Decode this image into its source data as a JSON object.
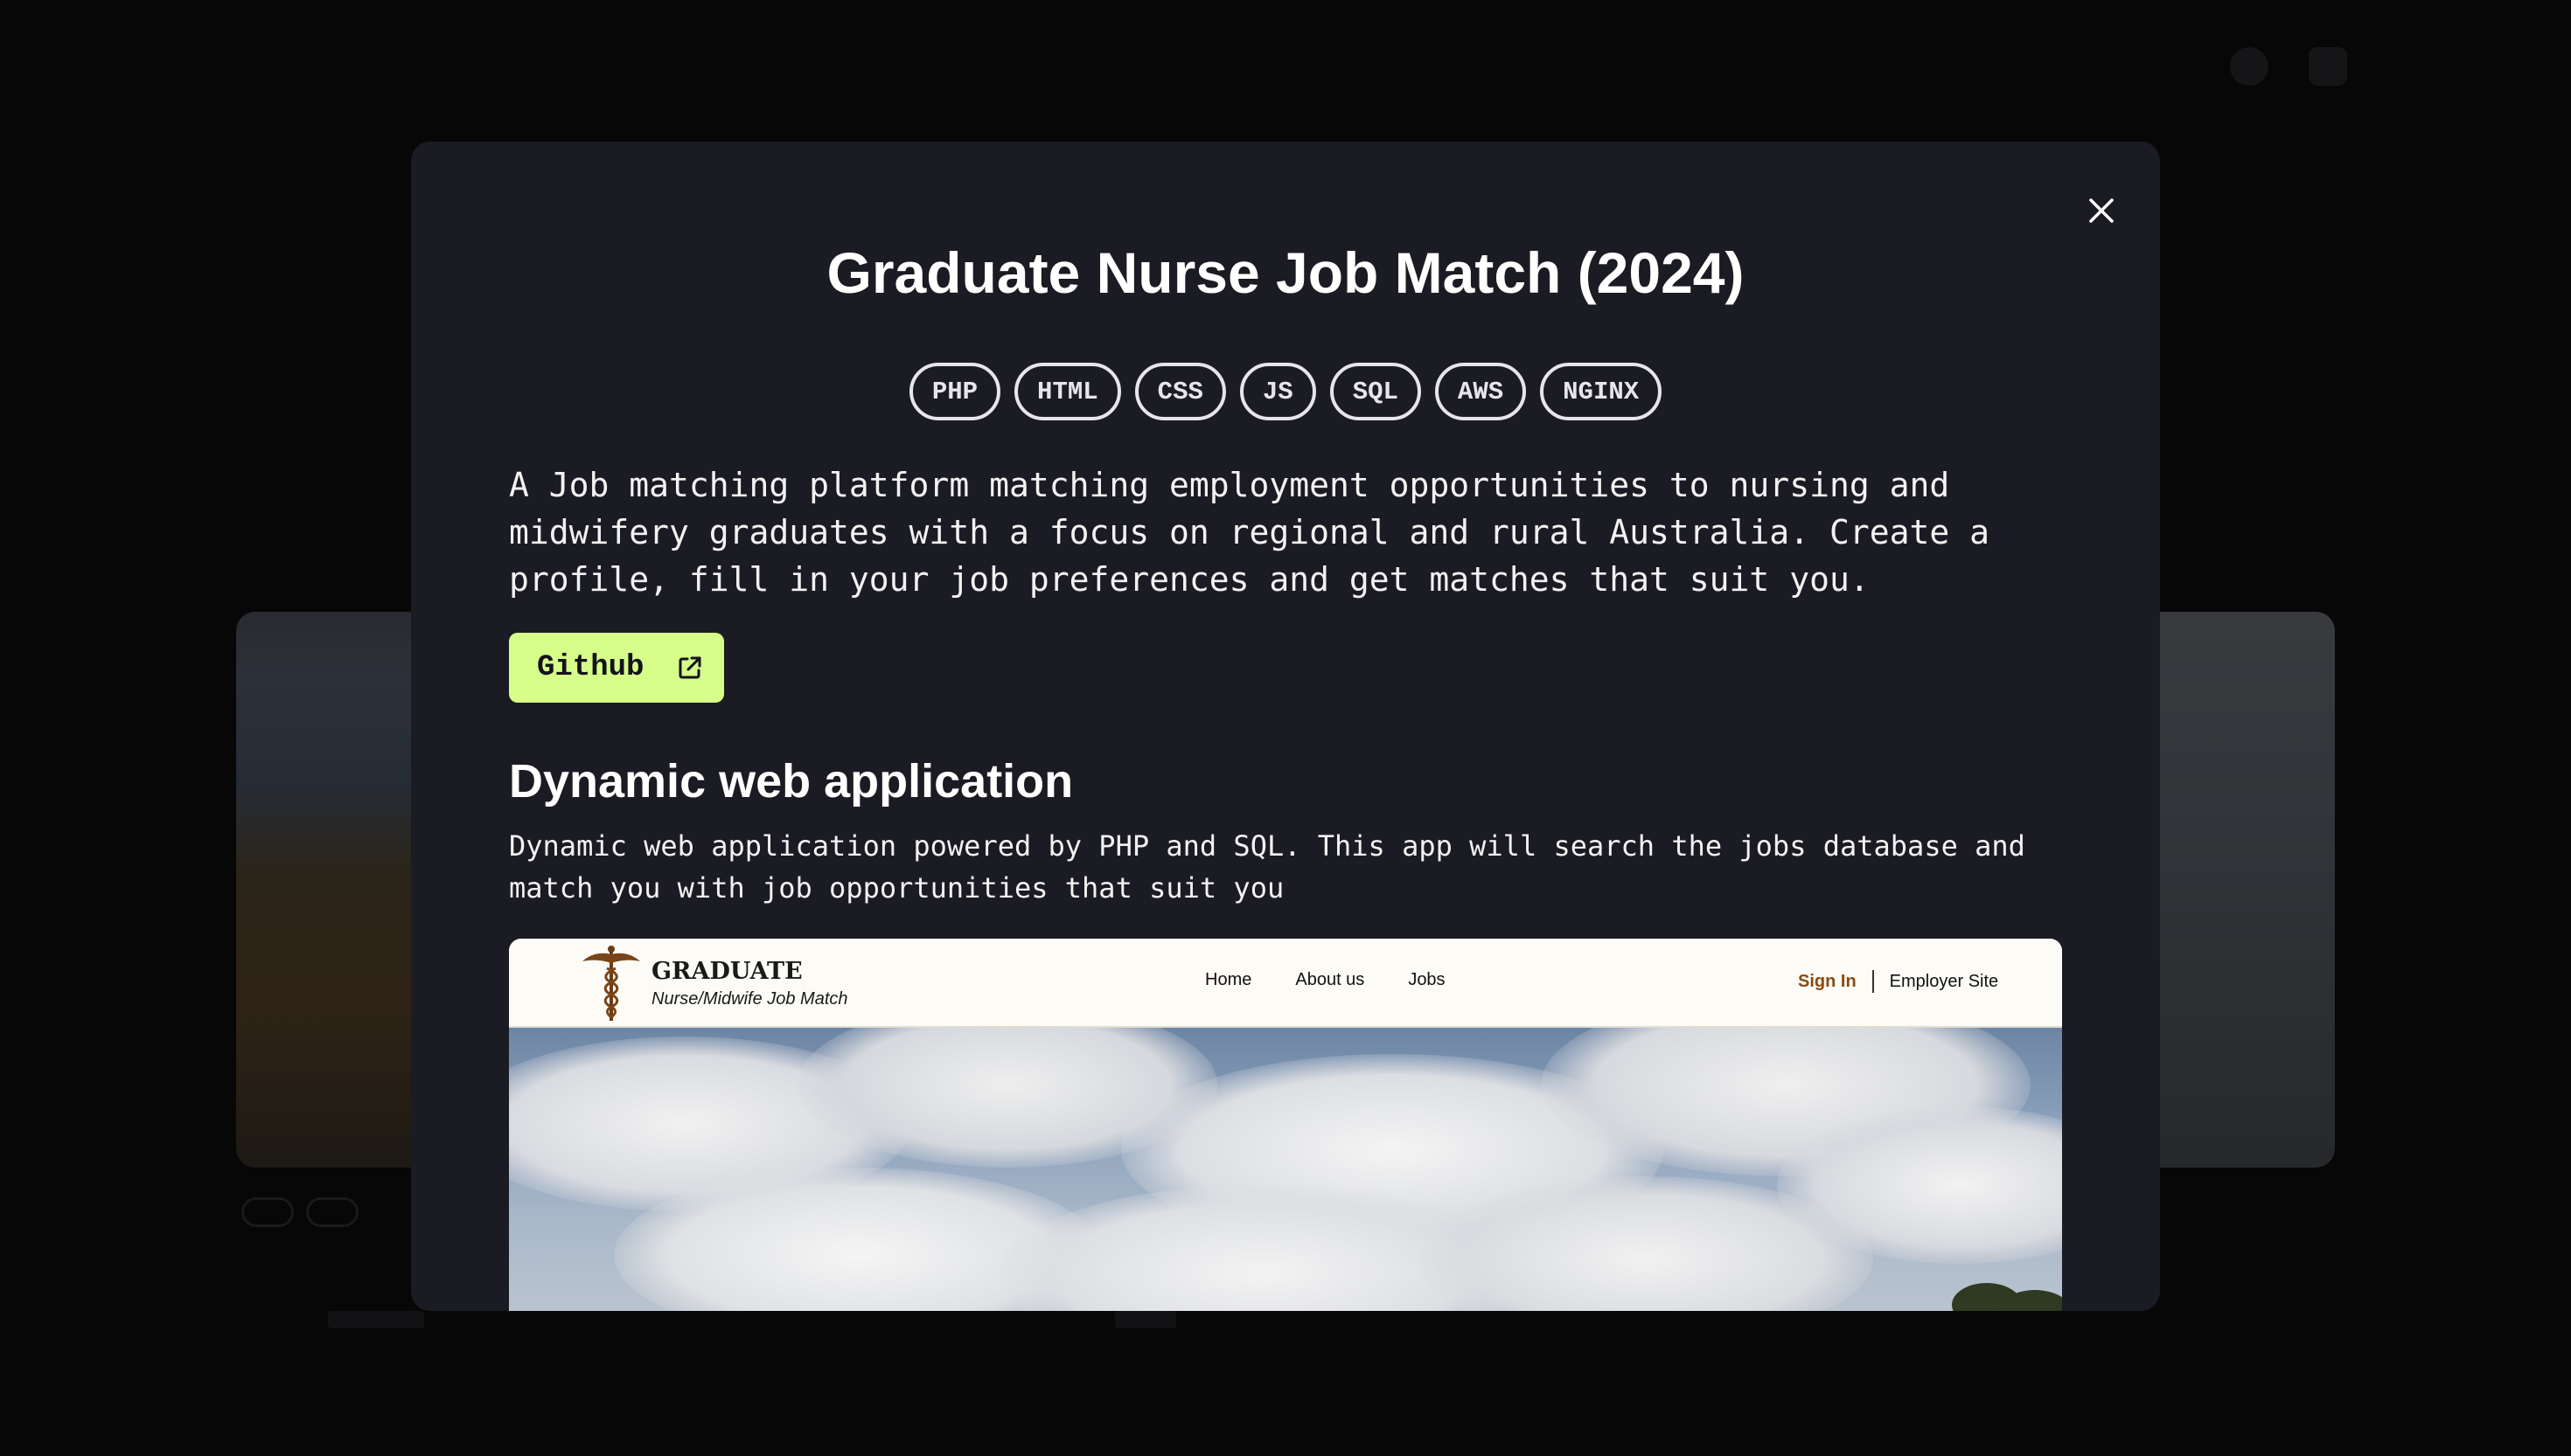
{
  "background": {
    "logo": "",
    "card_title": ""
  },
  "modal": {
    "title": "Graduate Nurse Job Match (2024)",
    "tags": [
      "PHP",
      "HTML",
      "CSS",
      "JS",
      "SQL",
      "AWS",
      "NGINX"
    ],
    "description": "A Job matching platform matching employment opportunities to nursing and midwifery graduates with a focus on regional and rural Australia. Create a profile, fill in your job preferences and get matches that suit you.",
    "github_label": "Github",
    "section": {
      "title": "Dynamic web application",
      "description": "Dynamic web application powered by PHP and SQL. This app will search the jobs database and match you with job opportunities that suit you"
    },
    "screenshot": {
      "brand_name": "GRADUATE",
      "brand_subtitle": "Nurse/Midwife Job Match",
      "nav": [
        "Home",
        "About us",
        "Jobs"
      ],
      "sign_in": "Sign In",
      "employer_site": "Employer Site"
    }
  },
  "colors": {
    "modal_bg": "#1b1b23",
    "accent_button": "#d6fd8a",
    "sign_in": "#8a4a12"
  },
  "icons": {
    "close": "close-icon",
    "github_external": "external-link-icon",
    "brand": "caduceus-icon"
  }
}
